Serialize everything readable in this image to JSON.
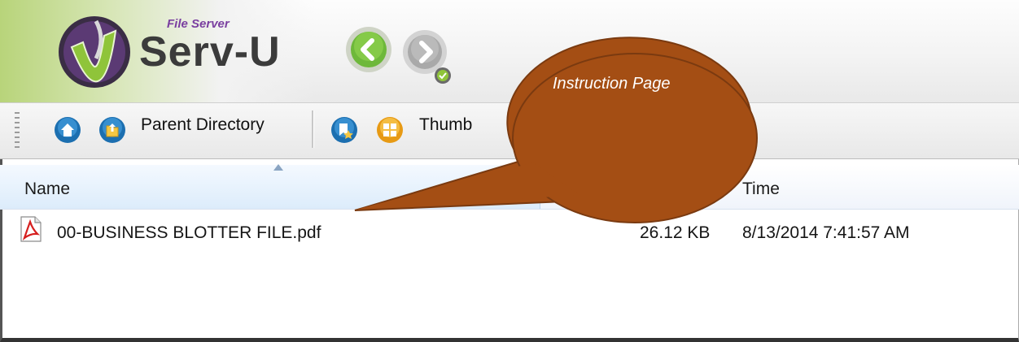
{
  "brand": {
    "subtitle": "File Server",
    "title": "Serv-U"
  },
  "navigation": {
    "back_icon": "back-arrow-icon",
    "forward_icon": "forward-arrow-icon"
  },
  "toolbar": {
    "home_icon": "home-icon",
    "parent_label": "Parent Directory",
    "bookmark_icon": "bookmark-icon",
    "thumbnails_label": "Thumb"
  },
  "file_list": {
    "columns": {
      "name": "Name",
      "time": "Time"
    },
    "rows": [
      {
        "icon": "pdf-file-icon",
        "name": "00-BUSINESS BLOTTER FILE.pdf",
        "size": "26.12 KB",
        "time": "8/13/2014 7:41:57 AM"
      }
    ]
  },
  "callout": {
    "text": "Instruction Page",
    "color": "#a44e14"
  },
  "colors": {
    "brand_green": "#8fc43a",
    "brand_purple": "#7a3fa0",
    "header_selected": "#dcecfb"
  }
}
